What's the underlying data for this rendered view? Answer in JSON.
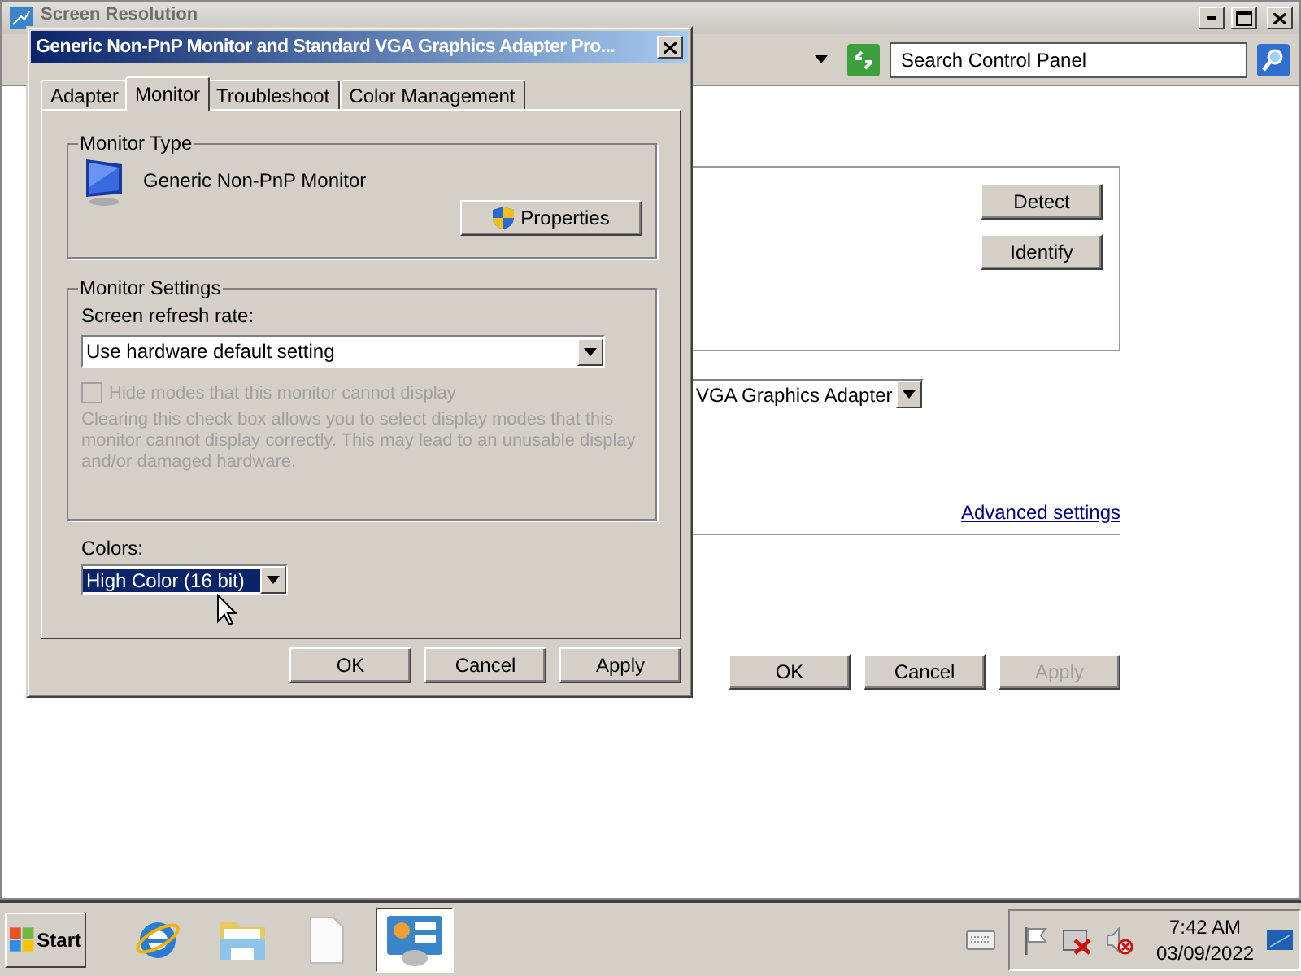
{
  "background_window": {
    "title": "Screen Resolution",
    "search": {
      "placeholder": "Search Control Panel"
    },
    "side_buttons": [
      {
        "label": "Detect",
        "disabled": false
      },
      {
        "label": "Identify",
        "disabled": false
      }
    ],
    "display_dropdown": {
      "value": "VGA Graphics Adapter"
    },
    "advanced_link": "Advanced settings",
    "buttons": [
      {
        "label": "OK",
        "disabled": false
      },
      {
        "label": "Cancel",
        "disabled": false
      },
      {
        "label": "Apply",
        "disabled": true
      }
    ]
  },
  "dialog": {
    "title": "Generic Non-PnP Monitor and Standard VGA Graphics Adapter Pro...",
    "tabs": [
      {
        "label": "Adapter",
        "selected": false
      },
      {
        "label": "Monitor",
        "selected": true
      },
      {
        "label": "Troubleshoot",
        "selected": false
      },
      {
        "label": "Color Management",
        "selected": false
      }
    ],
    "monitor_type": {
      "heading": "Monitor Type",
      "name": "Generic Non-PnP Monitor",
      "properties_button": "Properties"
    },
    "monitor_settings": {
      "heading": "Monitor Settings",
      "refresh_label": "Screen refresh rate:",
      "refresh_value": "Use hardware default setting",
      "hide_modes": {
        "label": "Hide modes that this monitor cannot display",
        "checked": false,
        "disabled": true
      },
      "note": "Clearing this check box allows you to select display modes that this monitor cannot display correctly. This may lead to an unusable display and/or damaged hardware."
    },
    "colors": {
      "label": "Colors:",
      "value": "High Color (16 bit)",
      "focused": true
    },
    "buttons": [
      {
        "label": "OK",
        "disabled": false
      },
      {
        "label": "Cancel",
        "disabled": false
      },
      {
        "label": "Apply",
        "disabled": false
      }
    ]
  },
  "taskbar": {
    "start": "Start",
    "apps": [
      {
        "kind": "browser",
        "selected": false
      },
      {
        "kind": "folder",
        "selected": false
      },
      {
        "kind": "document",
        "selected": false
      },
      {
        "kind": "control-panel",
        "selected": true
      }
    ],
    "clock": {
      "time": "7:42 AM",
      "date": "03/09/2022"
    }
  }
}
